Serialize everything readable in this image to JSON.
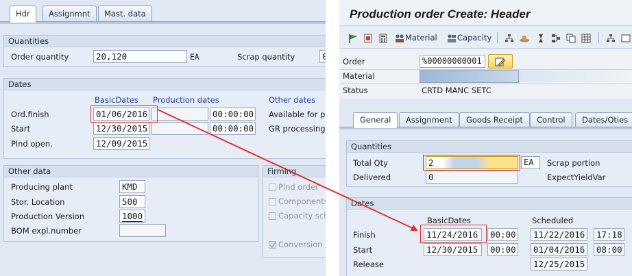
{
  "left": {
    "tabs": [
      {
        "label": "Hdr"
      },
      {
        "label": "Assignmnt"
      },
      {
        "label": "Mast. data"
      }
    ],
    "quantities": {
      "title": "Quantities",
      "order_quantity_label": "Order quantity",
      "order_quantity_value": "20,120",
      "order_quantity_unit": "EA",
      "scrap_quantity_label": "Scrap quantity",
      "scrap_quantity_value": "0"
    },
    "dates": {
      "title": "Dates",
      "col_basic": "BasicDates",
      "col_production": "Production dates",
      "col_other": "Other dates",
      "ord_finish_label": "Ord.finish",
      "ord_finish_basic": "01/06/2016",
      "ord_finish_time": "00:00:00",
      "start_label": "Start",
      "start_basic": "12/30/2015",
      "start_time": "00:00:00",
      "plnd_open_label": "Plnd open.",
      "plnd_open_basic": "12/09/2015",
      "available_label": "Available for pln",
      "gr_processing_label": "GR processing t"
    },
    "other_data": {
      "title": "Other data",
      "producing_plant_label": "Producing plant",
      "producing_plant_value": "KMD",
      "stor_location_label": "Stor. Location",
      "stor_location_value": "500",
      "production_version_label": "Production Version",
      "production_version_value": "1000",
      "bom_expl_label": "BOM expl.number",
      "bom_expl_value": ""
    },
    "firming": {
      "title": "Firming",
      "plnd_order": "Plnd order",
      "components": "Components",
      "capacity": "Capacity sche",
      "conversion": "Conversion in"
    }
  },
  "right": {
    "title": "Production order Create: Header",
    "toolbar": {
      "material_label": "Material",
      "capacity_label": "Capacity"
    },
    "header": {
      "order_label": "Order",
      "order_value": "%00000000001",
      "material_label": "Material",
      "material_value": "",
      "status_label": "Status",
      "status_value": "CRTD MANC SETC"
    },
    "tabs": [
      {
        "label": "General"
      },
      {
        "label": "Assignment"
      },
      {
        "label": "Goods Receipt"
      },
      {
        "label": "Control"
      },
      {
        "label": "Dates/Qties"
      }
    ],
    "quantities": {
      "title": "Quantities",
      "total_qty_label": "Total Qty",
      "total_qty_value": "2",
      "total_qty_unit": "EA",
      "scrap_portion_label": "Scrap portion",
      "delivered_label": "Delivered",
      "delivered_value": "0",
      "expect_yield_label": "ExpectYieldVar"
    },
    "dates": {
      "title": "Dates",
      "col_basic": "BasicDates",
      "col_scheduled": "Scheduled",
      "finish_label": "Finish",
      "finish_basic": "11/24/2016",
      "finish_basic_time": "00:00",
      "finish_sched": "11/22/2016",
      "finish_sched_time": "17:18",
      "start_label": "Start",
      "start_basic": "12/30/2015",
      "start_basic_time": "00:00",
      "start_sched": "01/04/2016",
      "start_sched_time": "08:00",
      "release_label": "Release",
      "release_sched": "12/25/2015"
    }
  },
  "colors": {
    "highlight": "#e2312c",
    "label_blue": "#1f3fa3",
    "background": "#dfe8f3"
  }
}
